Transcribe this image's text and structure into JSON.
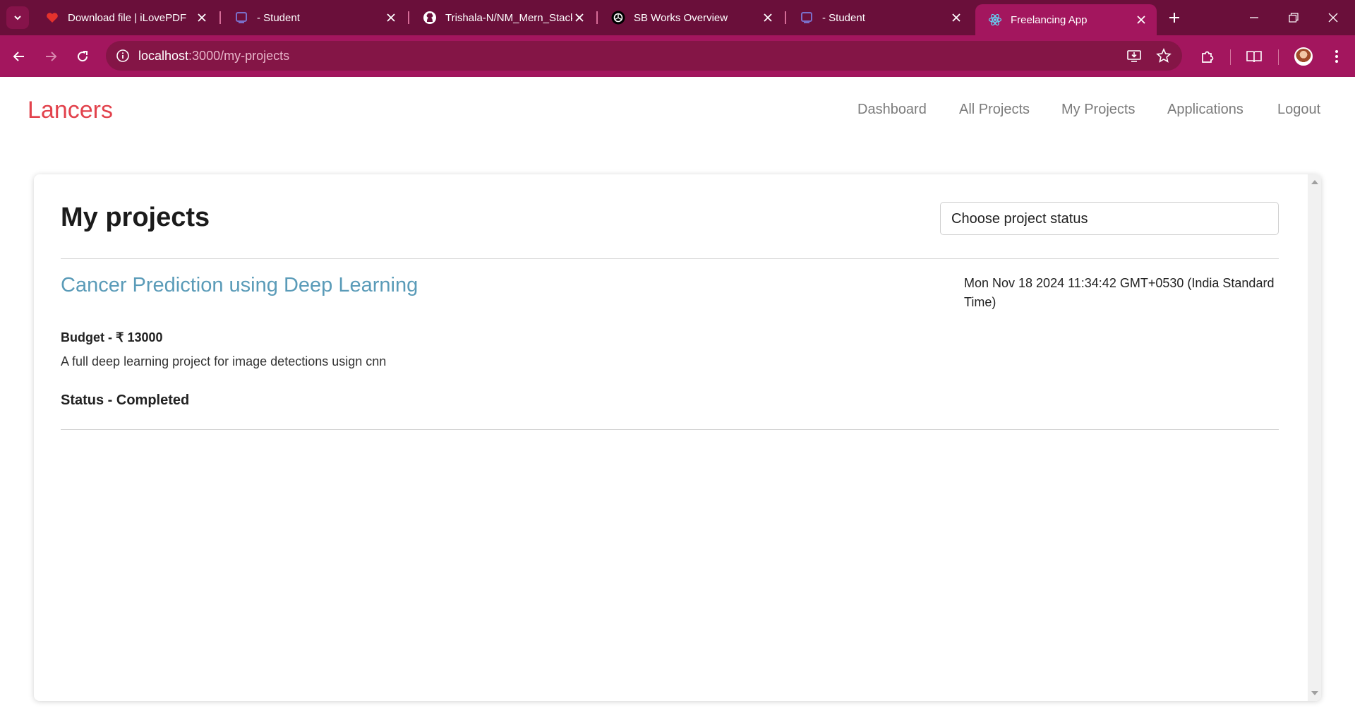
{
  "browser": {
    "tabs": [
      {
        "title": "Download file | iLovePDF",
        "icon": "ilovepdf-heart-icon",
        "active": false
      },
      {
        "title": "- Student",
        "icon": "student-portal-icon",
        "active": false
      },
      {
        "title": "Trishala-N/NM_Mern_Stack",
        "icon": "github-icon",
        "active": false
      },
      {
        "title": "SB Works Overview",
        "icon": "openai-icon",
        "active": false
      },
      {
        "title": "- Student",
        "icon": "student-portal-icon",
        "active": false
      },
      {
        "title": "Freelancing App",
        "icon": "react-icon",
        "active": true
      }
    ],
    "address": {
      "host": "localhost",
      "path": ":3000/my-projects"
    },
    "colors": {
      "tabstrip": "#6a0f3a",
      "toolbar": "#a3165e",
      "omnibox": "#841546"
    }
  },
  "app": {
    "brand": "Lancers",
    "brand_color": "#e2424c",
    "nav": [
      "Dashboard",
      "All Projects",
      "My Projects",
      "Applications",
      "Logout"
    ]
  },
  "main": {
    "heading": "My projects",
    "status_filter": {
      "selected": "Choose project status"
    },
    "projects": [
      {
        "title": "Cancer Prediction using Deep Learning",
        "date": "Mon Nov 18 2024 11:34:42 GMT+0530 (India Standard Time)",
        "budget": "Budget - ₹ 13000",
        "description": "A full deep learning project for image detections usign cnn",
        "status": "Status - Completed"
      }
    ],
    "title_color": "#5a9bb8"
  }
}
